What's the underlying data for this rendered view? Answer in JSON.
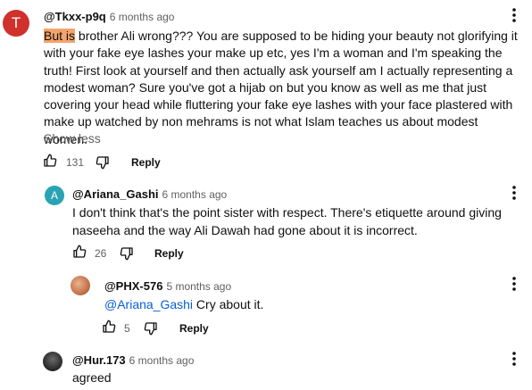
{
  "comments": [
    {
      "avatar_letter": "T",
      "avatar_color": "#d0312d",
      "handle": "@Tkxx-p9q",
      "time": "6 months ago",
      "text_highlight": "But is",
      "text_rest": " brother Ali wrong??? You are supposed to be hiding your beauty not glorifying it with your fake eye lashes your make up etc, yes I'm a woman and I'm speaking the truth! First look at yourself and then actually ask yourself am I actually representing a modest woman? Sure you've got a hijab on but you know as well as me that just covering your head while fluttering your fake eye lashes with your face plastered with make up watched by non mehrams is not what Islam teaches us about modest women.",
      "show_less": "Show less",
      "likes": "131",
      "reply_label": "Reply"
    },
    {
      "avatar_letter": "A",
      "avatar_color": "#2aa3b4",
      "handle": "@Ariana_Gashi",
      "time": "6 months ago",
      "text": "I don't think that's the point sister with respect. There's etiquette around giving naseeha and the way Ali Dawah had gone about it is incorrect.",
      "likes": "26",
      "reply_label": "Reply"
    },
    {
      "handle": "@PHX-576",
      "time": "5 months ago",
      "mention": "@Ariana_Gashi",
      "text": " Cry about it.",
      "likes": "5",
      "reply_label": "Reply"
    },
    {
      "handle": "@Hur.173",
      "time": "6 months ago",
      "text": "agreed"
    }
  ],
  "icons": {
    "like": "thumbs-up-icon",
    "dislike": "thumbs-down-icon",
    "menu": "more-vert-icon"
  }
}
